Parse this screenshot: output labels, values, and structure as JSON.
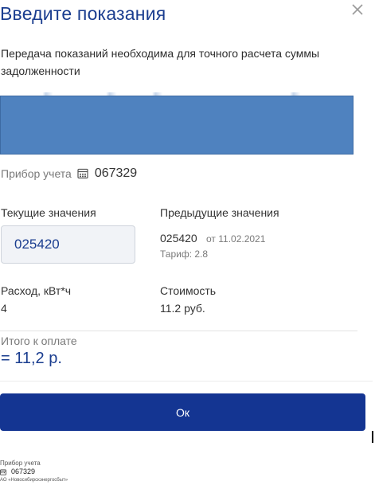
{
  "modal": {
    "title": "Введите показания",
    "subtitle": "Передача показаний необходима для точного расчета суммы задолженности"
  },
  "meter": {
    "label": "Прибор учета",
    "icon": "meter-calendar-icon",
    "number": "067329"
  },
  "readings": {
    "current_label": "Текущие значения",
    "current_value": "025420",
    "previous_label": "Предыдущие значения",
    "previous_value": "025420",
    "previous_date": "от 11.02.2021",
    "tariff": "Тариф: 2.8"
  },
  "consumption": {
    "label": "Расход, кВт*ч",
    "value": "4"
  },
  "cost": {
    "label": "Стоимость",
    "value": "11.2 руб."
  },
  "total": {
    "label": "Итого к оплате",
    "value": "= 11,2 р."
  },
  "actions": {
    "ok_label": "Ок"
  },
  "footer": {
    "meter_label": "Прибор учета",
    "meter_number": "067329",
    "company": "АО «Новосибирскэнергосбыт»"
  },
  "colors": {
    "title": "#1a3d8f",
    "button": "#143592",
    "redacted": "#4f82bf"
  }
}
